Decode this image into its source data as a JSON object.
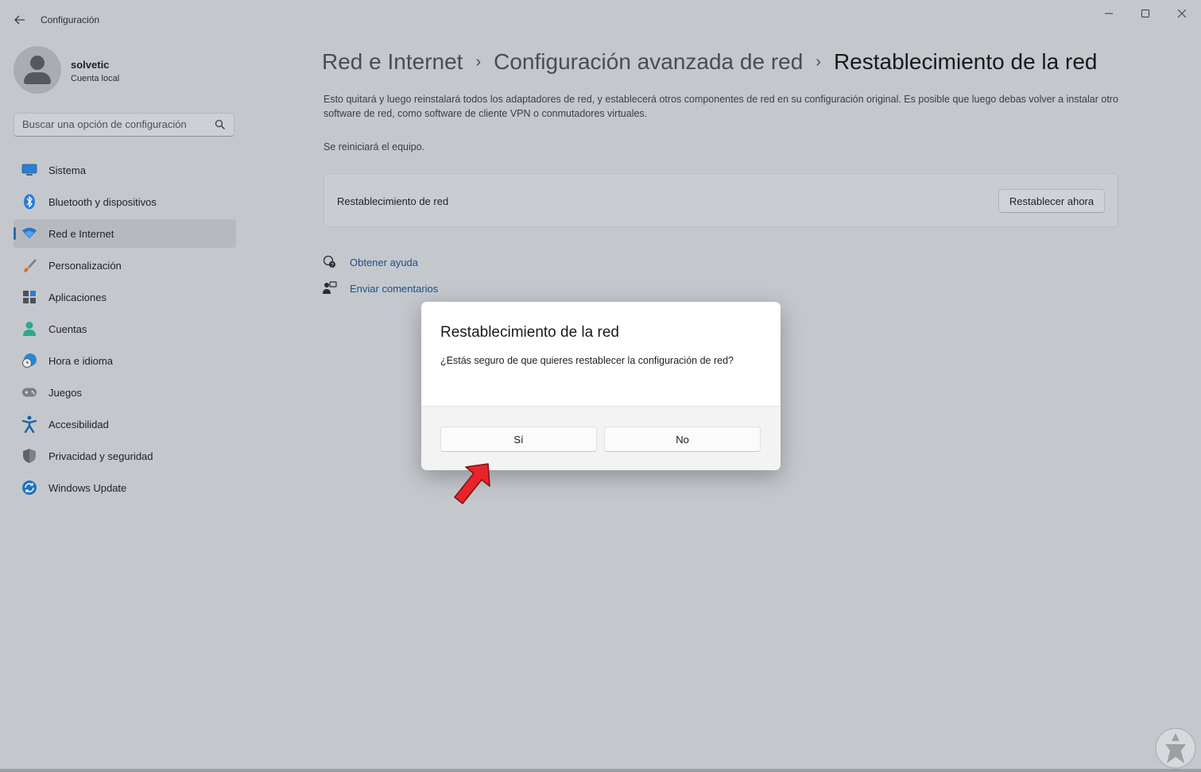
{
  "window": {
    "title": "Configuración"
  },
  "user": {
    "name": "solvetic",
    "account_type": "Cuenta local"
  },
  "search": {
    "placeholder": "Buscar una opción de configuración"
  },
  "nav": {
    "items": [
      {
        "label": "Sistema",
        "icon": "monitor-icon"
      },
      {
        "label": "Bluetooth y dispositivos",
        "icon": "bluetooth-icon"
      },
      {
        "label": "Red e Internet",
        "icon": "wifi-icon",
        "active": true
      },
      {
        "label": "Personalización",
        "icon": "brush-icon"
      },
      {
        "label": "Aplicaciones",
        "icon": "apps-icon"
      },
      {
        "label": "Cuentas",
        "icon": "person-icon"
      },
      {
        "label": "Hora e idioma",
        "icon": "globe-clock-icon"
      },
      {
        "label": "Juegos",
        "icon": "gamepad-icon"
      },
      {
        "label": "Accesibilidad",
        "icon": "accessibility-icon"
      },
      {
        "label": "Privacidad y seguridad",
        "icon": "shield-icon"
      },
      {
        "label": "Windows Update",
        "icon": "update-icon"
      }
    ]
  },
  "breadcrumb": {
    "items": [
      "Red e Internet",
      "Configuración avanzada de red",
      "Restablecimiento de la red"
    ]
  },
  "main": {
    "description": "Esto quitará y luego reinstalará todos los adaptadores de red, y establecerá otros componentes de red en su configuración original. Es posible que luego debas volver a instalar otro software de red, como software de cliente VPN o conmutadores virtuales.",
    "restart_note": "Se reiniciará el equipo.",
    "card_label": "Restablecimiento de red",
    "reset_button": "Restablecer ahora",
    "help_link": "Obtener ayuda",
    "feedback_link": "Enviar comentarios"
  },
  "dialog": {
    "title": "Restablecimiento de la red",
    "message": "¿Estás seguro de que quieres restablecer la configuración de red?",
    "yes_label": "Sí",
    "no_label": "No"
  },
  "colors": {
    "accent": "#2d6bb5",
    "arrow": "#e8242a",
    "link": "#1d4f85"
  }
}
